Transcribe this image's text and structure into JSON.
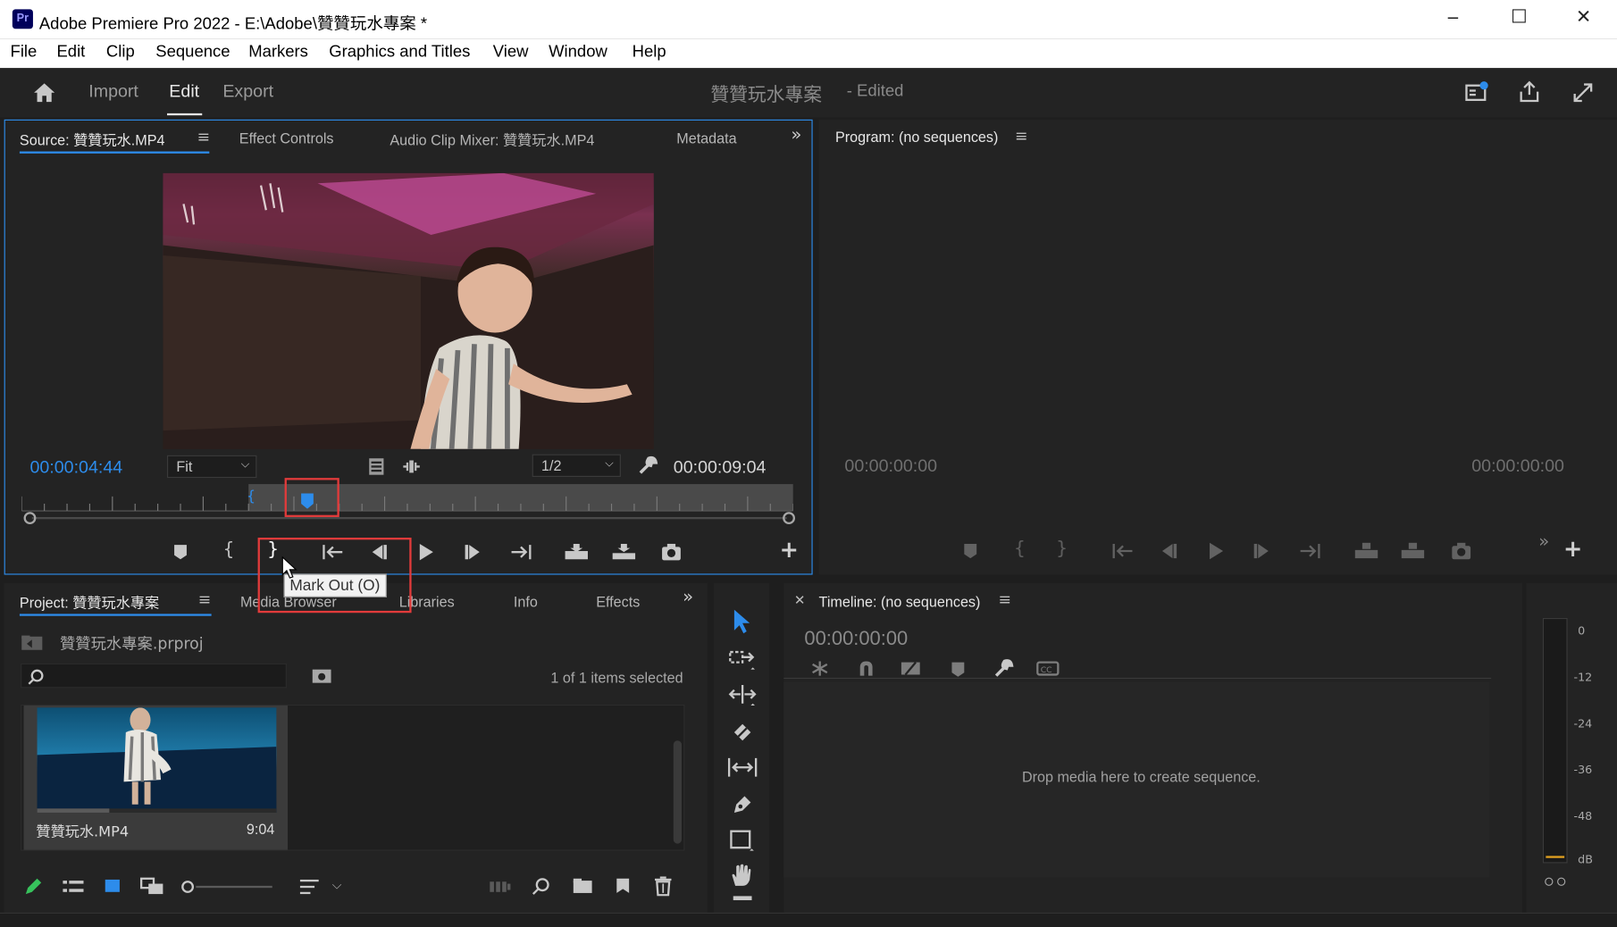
{
  "window": {
    "app_badge": "Pr",
    "title": "Adobe Premiere Pro 2022 - E:\\Adobe\\贊贊玩水專案 *",
    "minimize": "─",
    "maximize": "☐",
    "close": "✕"
  },
  "menu": [
    "File",
    "Edit",
    "Clip",
    "Sequence",
    "Markers",
    "Graphics and Titles",
    "View",
    "Window",
    "Help"
  ],
  "workspace": {
    "tabs": [
      "Import",
      "Edit",
      "Export"
    ],
    "active_tab": "Edit",
    "project_title": "贊贊玩水專案",
    "project_status": "- Edited"
  },
  "source_panel": {
    "tabs": [
      "Source: 贊贊玩水.MP4",
      "Effect Controls",
      "Audio Clip Mixer: 贊贊玩水.MP4",
      "Metadata"
    ],
    "active_tab": "Source: 贊贊玩水.MP4",
    "current_time": "00:00:04:44",
    "zoom": "Fit",
    "resolution": "1/2",
    "duration": "00:00:09:04",
    "playhead_fraction": 0.37,
    "tooltip": "Mark Out (O)"
  },
  "program_panel": {
    "title": "Program: (no sequences)",
    "current_time": "00:00:00:00",
    "duration": "00:00:00:00"
  },
  "project_panel": {
    "tabs": [
      "Project: 贊贊玩水專案",
      "Media Browser",
      "Libraries",
      "Info",
      "Effects"
    ],
    "active_tab": "Project: 贊贊玩水專案",
    "file_name": "贊贊玩水專案.prproj",
    "selection_status": "1 of 1 items selected",
    "items": [
      {
        "name": "贊贊玩水.MP4",
        "duration": "9:04"
      }
    ]
  },
  "timeline_panel": {
    "title": "Timeline: (no sequences)",
    "timecode": "00:00:00:00",
    "drop_hint": "Drop media here to create sequence."
  },
  "audio_meter": {
    "labels": [
      "0",
      "-12",
      "-24",
      "-36",
      "-48",
      "dB"
    ]
  },
  "colors": {
    "accent_blue": "#2d8ceb",
    "highlight_red": "#e23b3b",
    "panel_bg": "#232323"
  }
}
